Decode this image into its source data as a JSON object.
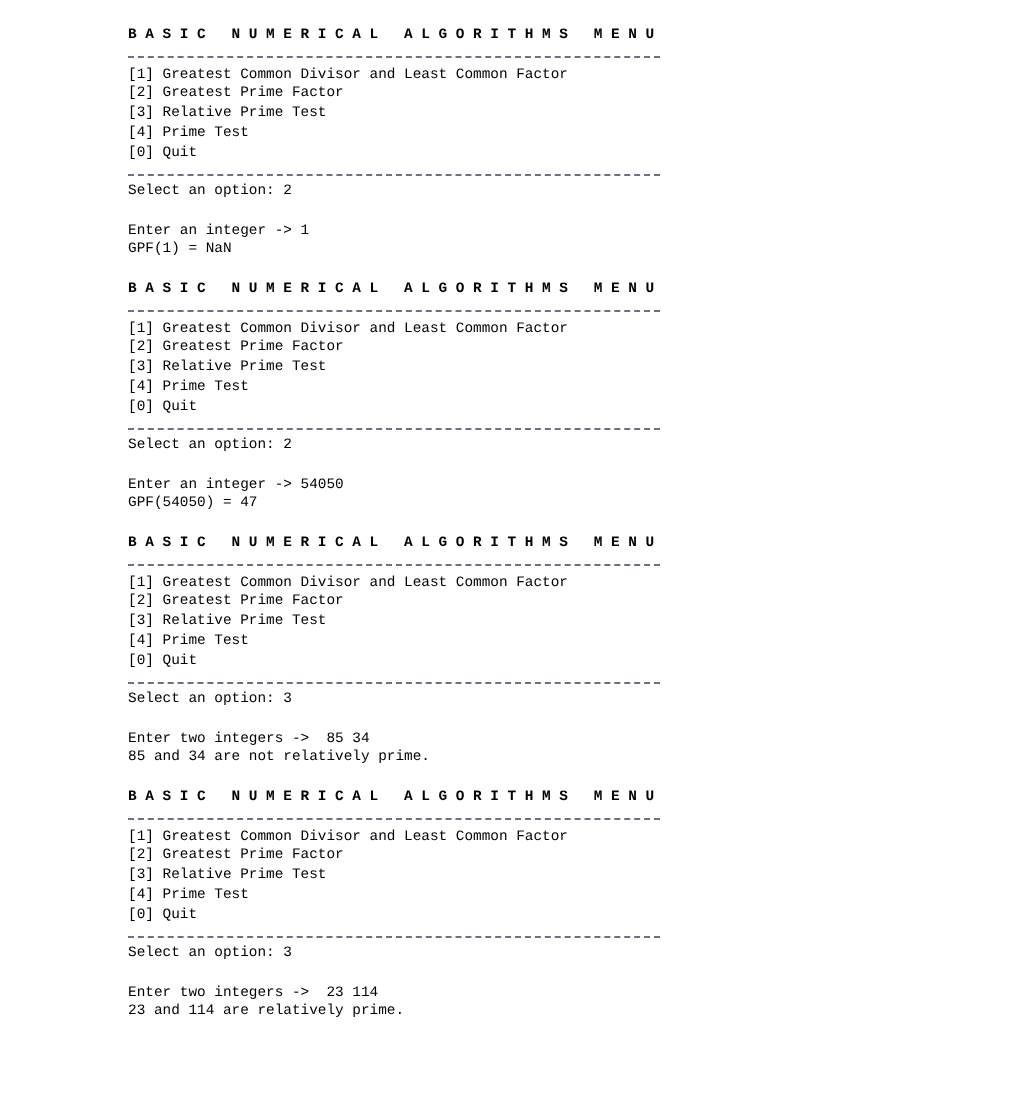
{
  "sessions": [
    {
      "title": "B A S I C   N U M E R I C A L   A L G O R I T H M S   M E N U",
      "options": [
        "[1] Greatest Common Divisor and Least Common Factor",
        "[2] Greatest Prime Factor",
        "[3] Relative Prime Test",
        "[4] Prime Test",
        "[0] Quit"
      ],
      "prompt": "Select an option: 2",
      "input": "Enter an integer -> 1",
      "result": "GPF(1) = NaN"
    },
    {
      "title": "B A S I C   N U M E R I C A L   A L G O R I T H M S   M E N U",
      "options": [
        "[1] Greatest Common Divisor and Least Common Factor",
        "[2] Greatest Prime Factor",
        "[3] Relative Prime Test",
        "[4] Prime Test",
        "[0] Quit"
      ],
      "prompt": "Select an option: 2",
      "input": "Enter an integer -> 54050",
      "result": "GPF(54050) = 47"
    },
    {
      "title": "B A S I C   N U M E R I C A L   A L G O R I T H M S   M E N U",
      "options": [
        "[1] Greatest Common Divisor and Least Common Factor",
        "[2] Greatest Prime Factor",
        "[3] Relative Prime Test",
        "[4] Prime Test",
        "[0] Quit"
      ],
      "prompt": "Select an option: 3",
      "input": "Enter two integers ->  85 34",
      "result": "85 and 34 are not relatively prime."
    },
    {
      "title": "B A S I C   N U M E R I C A L   A L G O R I T H M S   M E N U",
      "options": [
        "[1] Greatest Common Divisor and Least Common Factor",
        "[2] Greatest Prime Factor",
        "[3] Relative Prime Test",
        "[4] Prime Test",
        "[0] Quit"
      ],
      "prompt": "Select an option: 3",
      "input": "Enter two integers ->  23 114",
      "result": "23 and 114 are relatively prime."
    }
  ]
}
